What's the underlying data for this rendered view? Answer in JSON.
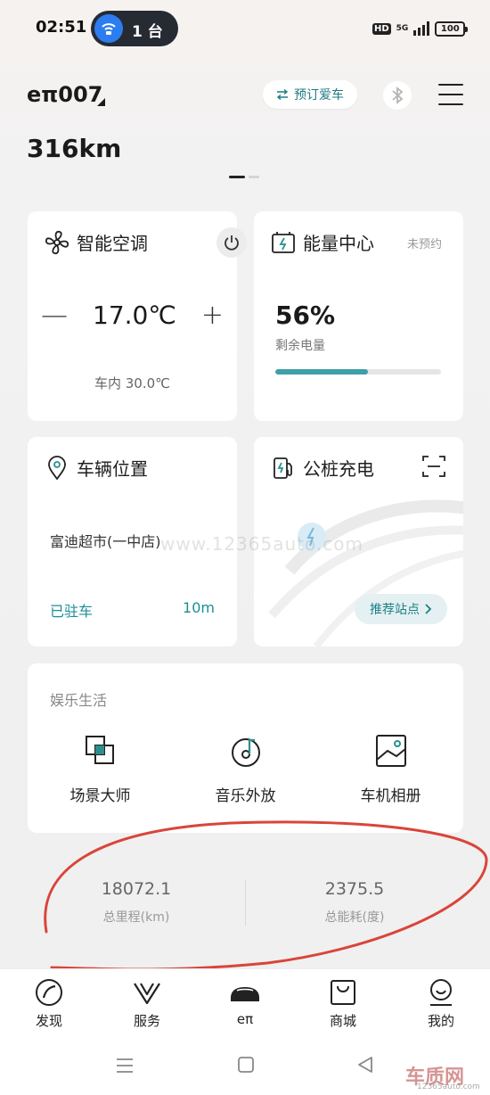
{
  "status_bar": {
    "time": "02:51",
    "hotspot_count": "1 台",
    "hd": "HD",
    "network": "5G",
    "battery": "100"
  },
  "header": {
    "car_name": "eπ007",
    "reserve_label": "预订爱车",
    "range": "316km"
  },
  "ac_card": {
    "title": "智能空调",
    "minus": "—",
    "plus": "+",
    "temperature": "17.0℃",
    "inside_temp": "车内 30.0℃"
  },
  "energy_card": {
    "title": "能量中心",
    "reservation_status": "未预约",
    "battery_percent": "56%",
    "battery_label": "剩余电量",
    "battery_level": 0.56
  },
  "location_card": {
    "title": "车辆位置",
    "place": "富迪超市(一中店)",
    "status": "已驻车",
    "distance": "10m"
  },
  "charging_card": {
    "title": "公桩充电",
    "recommend_label": "推荐站点"
  },
  "entertainment": {
    "title": "娱乐生活",
    "items": [
      {
        "label": "场景大师",
        "icon": "scene-icon"
      },
      {
        "label": "音乐外放",
        "icon": "music-icon"
      },
      {
        "label": "车机相册",
        "icon": "album-icon"
      }
    ]
  },
  "stats": {
    "mileage_value": "18072.1",
    "mileage_label": "总里程(km)",
    "energy_value": "2375.5",
    "energy_label": "总能耗(度)"
  },
  "bottom_nav": {
    "items": [
      {
        "label": "发现",
        "icon": "discover-icon"
      },
      {
        "label": "服务",
        "icon": "service-icon"
      },
      {
        "label": "eπ",
        "icon": "car-icon"
      },
      {
        "label": "商城",
        "icon": "shop-icon"
      },
      {
        "label": "我的",
        "icon": "profile-icon"
      }
    ]
  },
  "watermark": "www.12365auto.com",
  "brand": {
    "mark": "车质网",
    "url": "12365auto.com"
  },
  "colors": {
    "accent": "#1b8f95",
    "battery_fill": "#3e9fa8",
    "annotation": "#d9453a"
  }
}
